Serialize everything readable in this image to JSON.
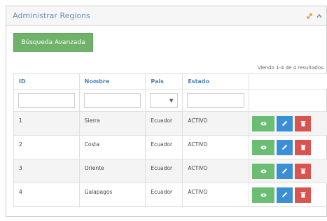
{
  "panel": {
    "title": "Administrar Regions"
  },
  "toolbar": {
    "advanced_search_label": "Búsqueda Avanzada"
  },
  "results_text": "Viendo 1-4 de 4 resultados.",
  "table": {
    "headers": [
      "ID",
      "Nombre",
      "Pais",
      "Estado"
    ],
    "rows": [
      {
        "id": "1",
        "nombre": "Sierra",
        "pais": "Ecuador",
        "estado": "ACTIVO"
      },
      {
        "id": "2",
        "nombre": "Costa",
        "pais": "Ecuador",
        "estado": "ACTIVO"
      },
      {
        "id": "3",
        "nombre": "Oriente",
        "pais": "Ecuador",
        "estado": "ACTIVO"
      },
      {
        "id": "4",
        "nombre": "Galapagos",
        "pais": "Ecuador",
        "estado": "ACTIVO"
      }
    ]
  },
  "icons": {
    "view": "eye-icon",
    "edit": "pencil-icon",
    "delete": "trash-icon",
    "expand": "expand-icon",
    "collapse": "chevron-up-icon"
  },
  "colors": {
    "title": "#6a8fb9",
    "header_text": "#4a80bd",
    "btn_advanced": "#70b26a",
    "btn_view": "#6bbd73",
    "btn_edit": "#3a8fd6",
    "btn_delete": "#d9534f"
  }
}
